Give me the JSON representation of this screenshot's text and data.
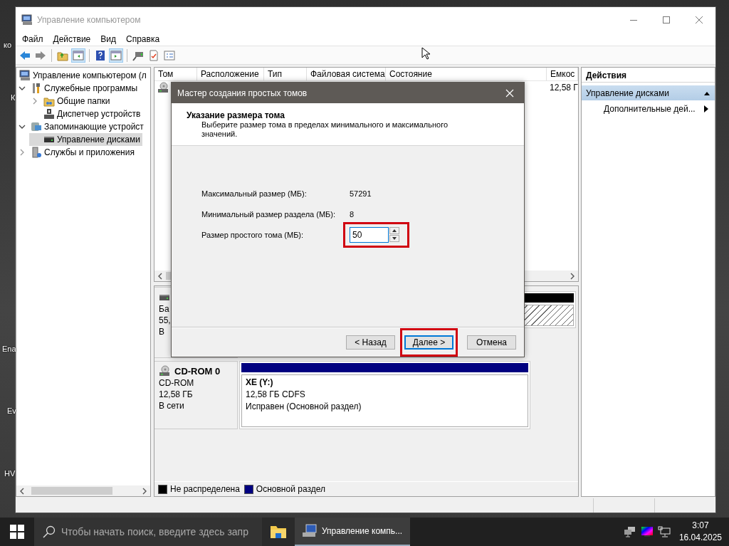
{
  "desktop": {
    "labels": [
      "ко",
      "К",
      "Ena",
      "Ev",
      "HV"
    ]
  },
  "window": {
    "title": "Управление компьютером"
  },
  "menu": [
    "Файл",
    "Действие",
    "Вид",
    "Справка"
  ],
  "toolbar": [
    {
      "kind": "button",
      "pressed": false
    },
    {
      "kind": "button",
      "pressed": false
    },
    {
      "kind": "separator"
    },
    {
      "kind": "button",
      "pressed": false
    },
    {
      "kind": "button",
      "pressed": true
    },
    {
      "kind": "separator"
    },
    {
      "kind": "button",
      "pressed": false
    },
    {
      "kind": "button",
      "pressed": true
    },
    {
      "kind": "separator"
    },
    {
      "kind": "button",
      "pressed": false
    },
    {
      "kind": "button",
      "pressed": false
    },
    {
      "kind": "button",
      "pressed": false
    }
  ],
  "tree": [
    {
      "label": "Управление компьютером (л",
      "selected": false,
      "children": [
        {
          "label": "Служебные программы",
          "selected": false,
          "expanded": true,
          "children": [
            {
              "label": "Общие папки",
              "selected": false,
              "expanded": false
            },
            {
              "label": "Диспетчер устройств",
              "selected": false
            }
          ]
        },
        {
          "label": "Запоминающие устройст",
          "selected": false,
          "expanded": true,
          "children": [
            {
              "label": "Управление дисками",
              "selected": true
            }
          ]
        },
        {
          "label": "Службы и приложения",
          "selected": false,
          "expanded": false
        }
      ]
    }
  ],
  "volumes": {
    "columns": [
      "Том",
      "Расположение",
      "Тип",
      "Файловая система",
      "Состояние",
      "Емкос"
    ],
    "rows": [
      {
        "capacity": "12,58 Г"
      }
    ]
  },
  "disks": [
    {
      "lines": [
        "Ба",
        "55,",
        "В"
      ],
      "partitions": [
        {
          "kind": "unallocated"
        }
      ]
    },
    {
      "name": "CD-ROM 0",
      "lines": [
        "CD-ROM",
        "12,58 ГБ",
        "В сети"
      ],
      "partitions": [
        {
          "kind": "primary",
          "title": "XE  (Y:)",
          "lines": [
            "12,58 ГБ CDFS",
            "Исправен (Основной раздел)"
          ]
        }
      ]
    }
  ],
  "legend": [
    {
      "kind": "unallocated",
      "label": "Не распределена",
      "color": "#000000"
    },
    {
      "kind": "primary",
      "label": "Основной раздел",
      "color": "#000080"
    }
  ],
  "actions": {
    "title": "Действия",
    "sections": [
      {
        "label": "Управление дисками",
        "expanded": true,
        "items": [
          {
            "label": "Дополнительные дей...",
            "submenu": true
          }
        ]
      }
    ]
  },
  "dialog": {
    "title": "Мастер создания простых томов",
    "heading": "Указание размера тома",
    "subtitle": "Выберите размер тома в пределах минимального и максимального значений.",
    "fields": [
      {
        "kind": "readout",
        "label": "Максимальный размер (МБ):",
        "value": "57291"
      },
      {
        "kind": "readout",
        "label": "Минимальный размер раздела (МБ):",
        "value": "8"
      },
      {
        "kind": "spinner",
        "label": "Размер простого тома (МБ):",
        "value": "50",
        "highlighted": true
      }
    ],
    "buttons": [
      {
        "label": "< Назад",
        "default": false,
        "highlighted": false
      },
      {
        "label": "Далее >",
        "default": true,
        "highlighted": true
      },
      {
        "label": "Отмена",
        "default": false,
        "highlighted": false
      }
    ]
  },
  "taskbar": {
    "placeholder": "Чтобы начать поиск, введите здесь запр",
    "apps": [
      {
        "kind": "folder",
        "active": false
      },
      {
        "kind": "app",
        "label": "Управление компь...",
        "active": true
      }
    ],
    "time": "3:07",
    "date": "16.04.2025"
  }
}
